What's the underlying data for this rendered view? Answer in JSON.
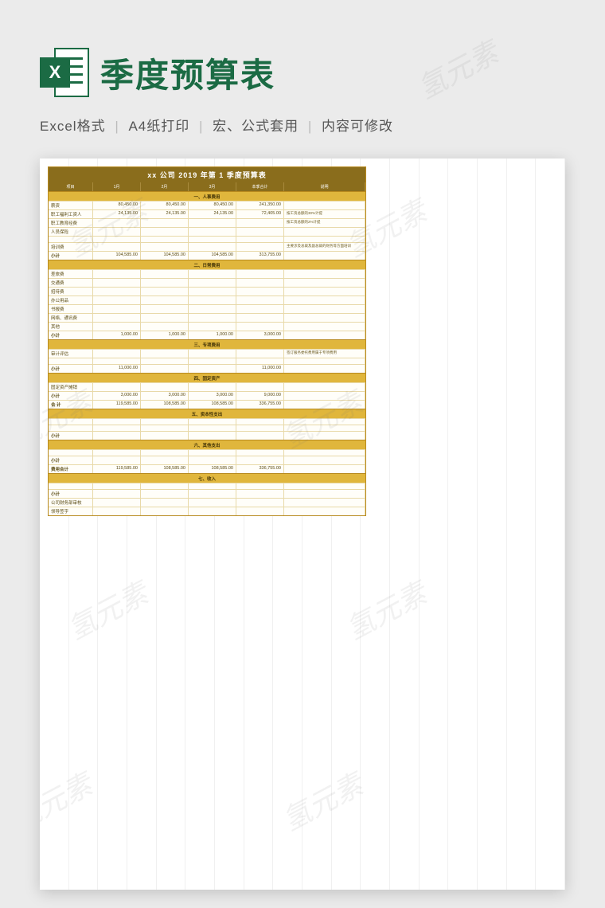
{
  "header": {
    "icon_letter": "X",
    "title": "季度预算表"
  },
  "meta": {
    "format": "Excel格式",
    "print": "A4纸打印",
    "macro": "宏、公式套用",
    "editable": "内容可修改"
  },
  "watermark": "氢元素",
  "sheet": {
    "title": "xx 公司 2019 年第  1  季度预算表",
    "columns": {
      "label": "项目",
      "m1": "1月",
      "m2": "2月",
      "m3": "3月",
      "total": "本季合计",
      "note": "说明"
    },
    "sections": [
      {
        "name": "一、人事费用",
        "rows": [
          {
            "label": "薪资",
            "m1": "80,450.00",
            "m2": "80,450.00",
            "m3": "80,450.00",
            "total": "241,350.00",
            "note": ""
          },
          {
            "label": "职工福利工资人",
            "m1": "24,135.00",
            "m2": "24,135.00",
            "m3": "24,135.00",
            "total": "72,405.00",
            "note": "按工资总额的30%计提"
          },
          {
            "label": "职工教育经费",
            "m1": "",
            "m2": "",
            "m3": "",
            "total": "",
            "note": "按工资总额的2%计提"
          },
          {
            "label": "人员保险",
            "m1": "",
            "m2": "",
            "m3": "",
            "total": "",
            "note": ""
          },
          {
            "label": "",
            "m1": "",
            "m2": "",
            "m3": "",
            "total": "",
            "note": ""
          },
          {
            "label": "培训费",
            "m1": "",
            "m2": "",
            "m3": "",
            "total": "",
            "note": "主要涉及总裁及副总裁的财务等方面培训"
          },
          {
            "label": "小计",
            "m1": "104,585.00",
            "m2": "104,585.00",
            "m3": "104,585.00",
            "total": "313,755.00",
            "note": ""
          }
        ]
      },
      {
        "name": "二、日常费用",
        "rows": [
          {
            "label": "差旅费",
            "m1": "",
            "m2": "",
            "m3": "",
            "total": "",
            "note": ""
          },
          {
            "label": "交通费",
            "m1": "",
            "m2": "",
            "m3": "",
            "total": "",
            "note": ""
          },
          {
            "label": "招待费",
            "m1": "",
            "m2": "",
            "m3": "",
            "total": "",
            "note": ""
          },
          {
            "label": "办公用品",
            "m1": "",
            "m2": "",
            "m3": "",
            "total": "",
            "note": ""
          },
          {
            "label": "书报费",
            "m1": "",
            "m2": "",
            "m3": "",
            "total": "",
            "note": ""
          },
          {
            "label": "网络、通讯费",
            "m1": "",
            "m2": "",
            "m3": "",
            "total": "",
            "note": ""
          },
          {
            "label": "其他",
            "m1": "",
            "m2": "",
            "m3": "",
            "total": "",
            "note": ""
          },
          {
            "label": "小计",
            "m1": "1,000.00",
            "m2": "1,000.00",
            "m3": "1,000.00",
            "total": "3,000.00",
            "note": ""
          }
        ]
      },
      {
        "name": "三、专项费用",
        "rows": [
          {
            "label": "审计评估",
            "m1": "",
            "m2": "",
            "m3": "",
            "total": "",
            "note": "签订服务委托费用属于专项费用"
          },
          {
            "label": "",
            "m1": "",
            "m2": "",
            "m3": "",
            "total": "",
            "note": ""
          },
          {
            "label": "小计",
            "m1": "11,000.00",
            "m2": "",
            "m3": "",
            "total": "11,000.00",
            "note": ""
          }
        ]
      },
      {
        "name": "四、固定资产",
        "rows": [
          {
            "label": "固定资产摊销",
            "m1": "",
            "m2": "",
            "m3": "",
            "total": "",
            "note": ""
          },
          {
            "label": "小计",
            "m1": "3,000.00",
            "m2": "3,000.00",
            "m3": "3,000.00",
            "total": "9,000.00",
            "note": ""
          },
          {
            "label": "合 计",
            "m1": "119,585.00",
            "m2": "108,585.00",
            "m3": "108,585.00",
            "total": "336,755.00",
            "note": ""
          }
        ]
      },
      {
        "name": "五、资本性支出",
        "rows": [
          {
            "label": "",
            "m1": "",
            "m2": "",
            "m3": "",
            "total": "",
            "note": ""
          },
          {
            "label": "",
            "m1": "",
            "m2": "",
            "m3": "",
            "total": "",
            "note": ""
          },
          {
            "label": "小计",
            "m1": "",
            "m2": "",
            "m3": "",
            "total": "",
            "note": ""
          }
        ]
      },
      {
        "name": "六、其他支出",
        "rows": [
          {
            "label": "",
            "m1": "",
            "m2": "",
            "m3": "",
            "total": "",
            "note": ""
          },
          {
            "label": "小计",
            "m1": "",
            "m2": "",
            "m3": "",
            "total": "",
            "note": ""
          },
          {
            "label": "费用合计",
            "m1": "119,585.00",
            "m2": "108,585.00",
            "m3": "108,585.00",
            "total": "336,755.00",
            "note": ""
          }
        ]
      },
      {
        "name": "七、收入",
        "rows": [
          {
            "label": "",
            "m1": "",
            "m2": "",
            "m3": "",
            "total": "",
            "note": ""
          },
          {
            "label": "小计",
            "m1": "",
            "m2": "",
            "m3": "",
            "total": "",
            "note": ""
          },
          {
            "label": "公司财务部审核",
            "m1": "",
            "m2": "",
            "m3": "",
            "total": "",
            "note": ""
          },
          {
            "label": "领导签字",
            "m1": "",
            "m2": "",
            "m3": "",
            "total": "",
            "note": ""
          }
        ]
      }
    ]
  }
}
